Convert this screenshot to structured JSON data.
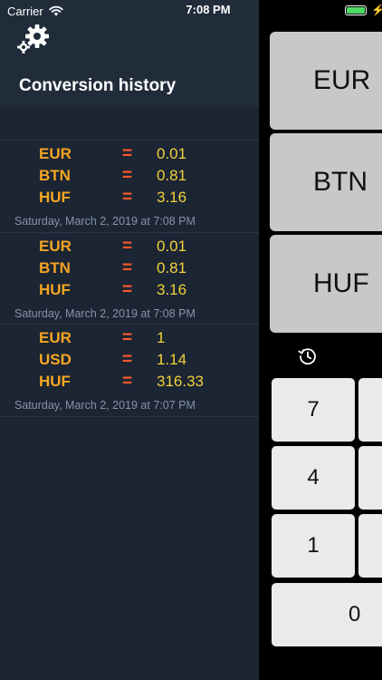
{
  "status_bar": {
    "carrier": "Carrier",
    "time": "7:08 PM"
  },
  "drawer": {
    "title": "Conversion history",
    "entries": [
      {
        "rows": [
          {
            "code": "EUR",
            "eq": "=",
            "value": "0.01"
          },
          {
            "code": "BTN",
            "eq": "=",
            "value": "0.81"
          },
          {
            "code": "HUF",
            "eq": "=",
            "value": "3.16"
          }
        ],
        "timestamp": "Saturday, March 2, 2019 at 7:08 PM"
      },
      {
        "rows": [
          {
            "code": "EUR",
            "eq": "=",
            "value": "0.01"
          },
          {
            "code": "BTN",
            "eq": "=",
            "value": "0.81"
          },
          {
            "code": "HUF",
            "eq": "=",
            "value": "3.16"
          }
        ],
        "timestamp": "Saturday, March 2, 2019 at 7:08 PM"
      },
      {
        "rows": [
          {
            "code": "EUR",
            "eq": "=",
            "value": "1"
          },
          {
            "code": "USD",
            "eq": "=",
            "value": "1.14"
          },
          {
            "code": "HUF",
            "eq": "=",
            "value": "316.33"
          }
        ],
        "timestamp": "Saturday, March 2, 2019 at 7:07 PM"
      }
    ]
  },
  "currencies": [
    "EUR",
    "BTN",
    "HUF"
  ],
  "keypad": {
    "k7": "7",
    "k4": "4",
    "k1": "1",
    "k0": "0"
  },
  "colors": {
    "drawer_bg": "#1b2533",
    "currency_code": "#f5a623",
    "equals": "#ff5a2a",
    "value": "#f2d13b",
    "battery": "#4cd964"
  }
}
